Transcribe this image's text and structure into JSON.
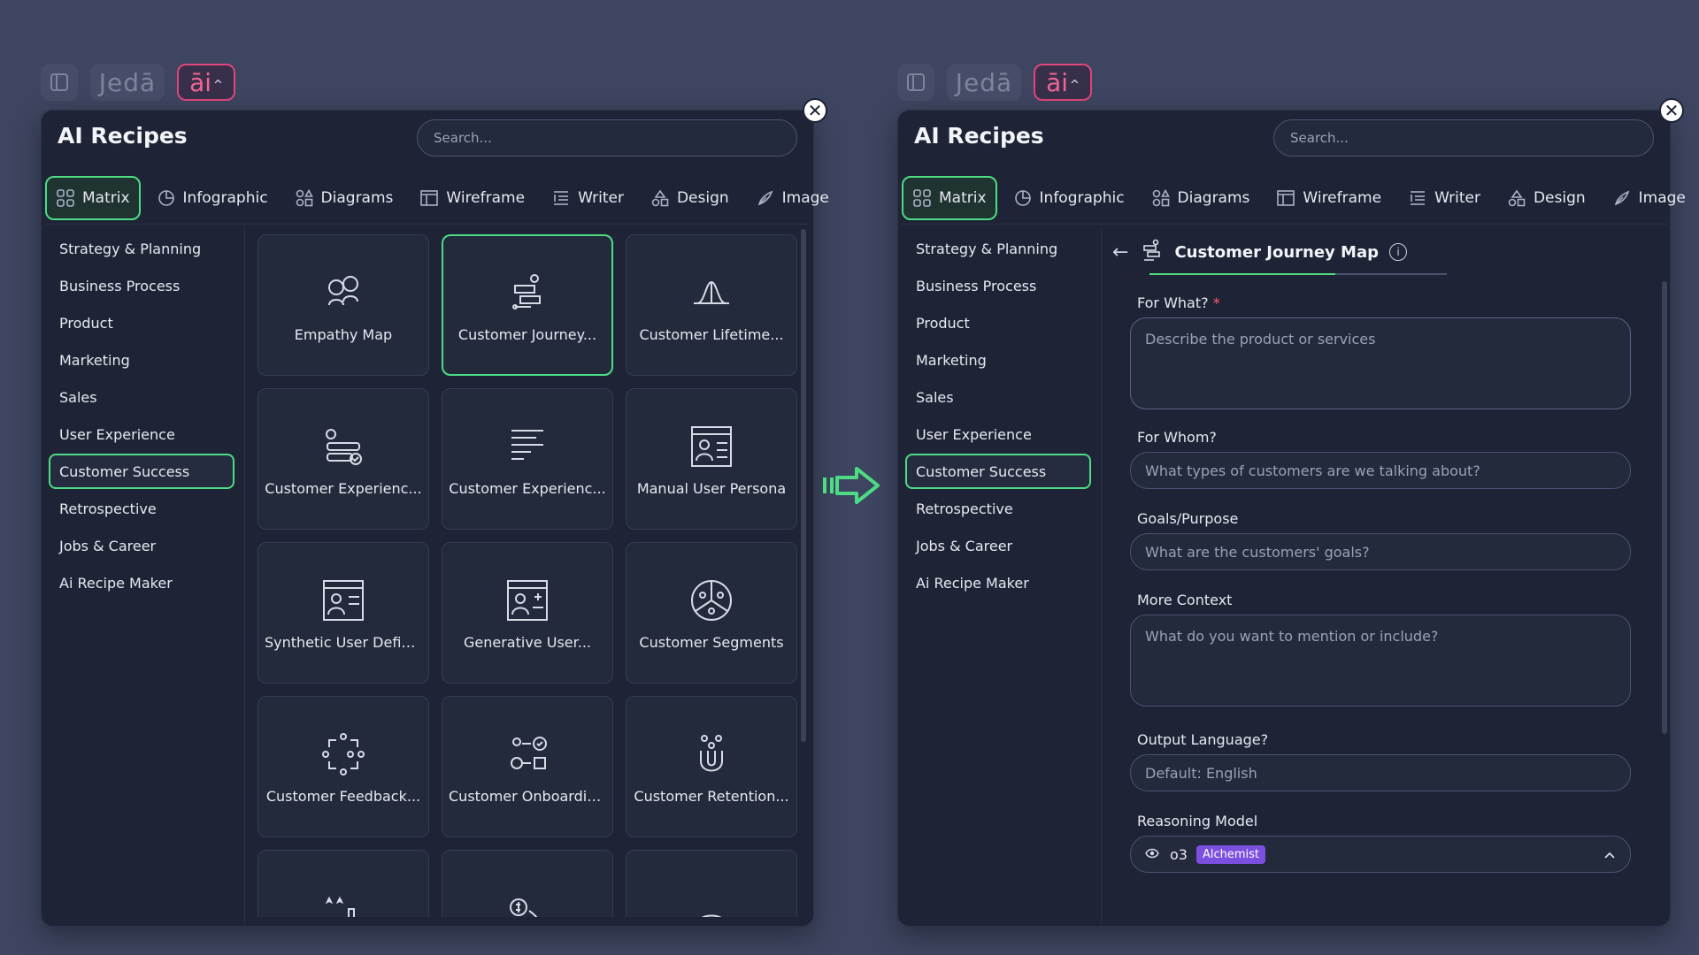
{
  "toolbar": {
    "jeda": "Jedā",
    "ai": "āi",
    "caret": "^"
  },
  "panel": {
    "title": "AI Recipes",
    "search_placeholder": "Search...",
    "close": "✕"
  },
  "tabs": [
    {
      "label": "Matrix",
      "icon": "grid-icon"
    },
    {
      "label": "Infographic",
      "icon": "pie-icon"
    },
    {
      "label": "Diagrams",
      "icon": "shapes-icon"
    },
    {
      "label": "Wireframe",
      "icon": "wireframe-icon"
    },
    {
      "label": "Writer",
      "icon": "writer-icon"
    },
    {
      "label": "Design",
      "icon": "design-icon"
    },
    {
      "label": "Image",
      "icon": "image-icon"
    }
  ],
  "sidebar": [
    "Strategy & Planning",
    "Business Process",
    "Product",
    "Marketing",
    "Sales",
    "User Experience",
    "Customer Success",
    "Retrospective",
    "Jobs & Career",
    "Ai Recipe Maker"
  ],
  "cards": [
    {
      "label": "Empathy Map",
      "icon": "empathy-icon"
    },
    {
      "label": "Customer Journey...",
      "icon": "journey-icon"
    },
    {
      "label": "Customer Lifetime...",
      "icon": "lifetime-icon"
    },
    {
      "label": "Customer Experienc...",
      "icon": "experience-icon"
    },
    {
      "label": "Customer Experienc...",
      "icon": "experience-list-icon"
    },
    {
      "label": "Manual User Persona",
      "icon": "persona-icon"
    },
    {
      "label": "Synthetic User Defin...",
      "icon": "synthetic-user-icon"
    },
    {
      "label": "Generative User...",
      "icon": "generative-user-icon"
    },
    {
      "label": "Customer Segments",
      "icon": "segments-icon"
    },
    {
      "label": "Customer Feedback...",
      "icon": "feedback-icon"
    },
    {
      "label": "Customer Onboardin...",
      "icon": "onboarding-icon"
    },
    {
      "label": "Customer Retention...",
      "icon": "retention-icon"
    },
    {
      "label": "",
      "icon": "rating-chart-icon"
    },
    {
      "label": "",
      "icon": "money-icon"
    },
    {
      "label": "",
      "icon": "dome-icon"
    }
  ],
  "form": {
    "back": "←",
    "title": "Customer Journey Map",
    "info": "i",
    "for_what_label": "For What?",
    "required_mark": "*",
    "for_what_placeholder": "Describe the product or services",
    "for_whom_label": "For Whom?",
    "for_whom_placeholder": "What types of customers are we talking about?",
    "goals_label": "Goals/Purpose",
    "goals_placeholder": "What are the customers' goals?",
    "context_label": "More Context",
    "context_placeholder": "What do you want to mention or include?",
    "language_label": "Output Language?",
    "language_placeholder": "Default: English",
    "model_label": "Reasoning Model",
    "model_value": "o3",
    "model_badge": "Alchemist"
  },
  "colors": {
    "accent": "#4ddc84",
    "ai": "#e0457b",
    "badge": "#7b4fe0",
    "bg": "#3d4560",
    "panel": "#1e2436"
  }
}
